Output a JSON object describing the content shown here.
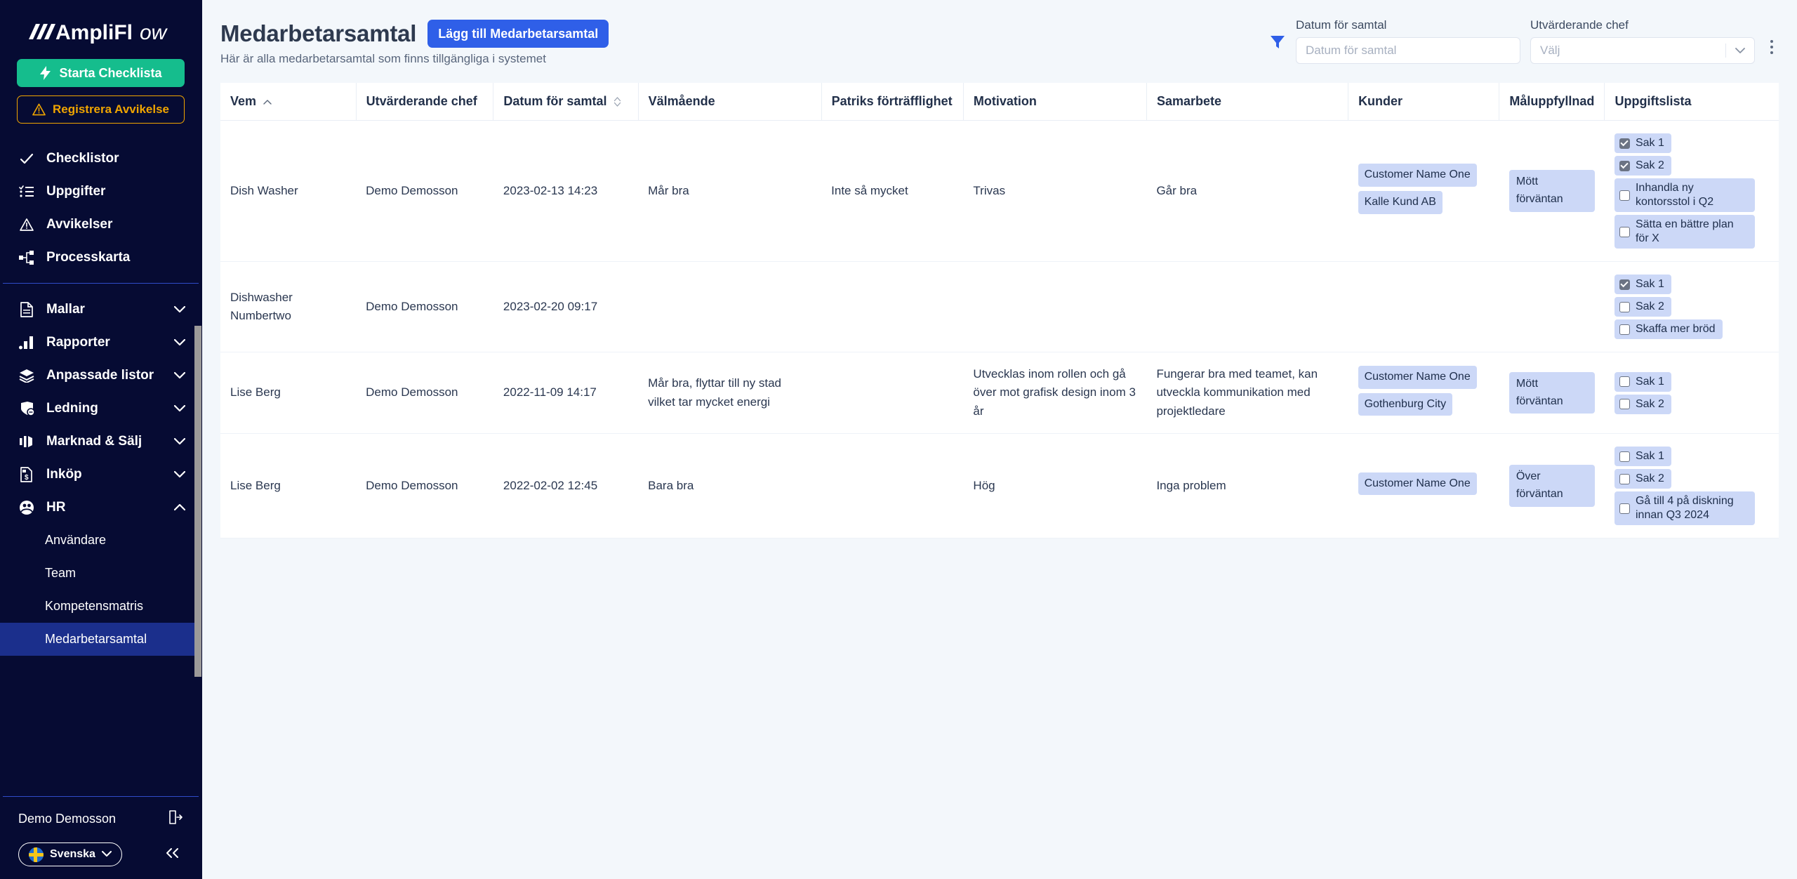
{
  "brand": {
    "name": "AmpliFlow"
  },
  "sidebar": {
    "cta": [
      {
        "label": "Starta Checklista",
        "icon": "lightning-icon"
      },
      {
        "label": "Registrera Avvikelse",
        "icon": "warning-triangle-icon"
      }
    ],
    "nav": [
      {
        "label": "Checklistor",
        "icon": "check-icon",
        "expandable": false
      },
      {
        "label": "Uppgifter",
        "icon": "task-list-icon",
        "expandable": false
      },
      {
        "label": "Avvikelser",
        "icon": "warning-triangle-icon",
        "expandable": false
      },
      {
        "label": "Processkarta",
        "icon": "process-map-icon",
        "expandable": false
      },
      {
        "label": "Mallar",
        "icon": "document-icon",
        "expandable": true,
        "expanded": false
      },
      {
        "label": "Rapporter",
        "icon": "bar-chart-icon",
        "expandable": true,
        "expanded": false
      },
      {
        "label": "Anpassade listor",
        "icon": "layers-icon",
        "expandable": true,
        "expanded": false
      },
      {
        "label": "Ledning",
        "icon": "shield-icon",
        "expandable": true,
        "expanded": false
      },
      {
        "label": "Marknad & Sälj",
        "icon": "megaphone-icon",
        "expandable": true,
        "expanded": false
      },
      {
        "label": "Inköp",
        "icon": "invoice-icon",
        "expandable": true,
        "expanded": false
      },
      {
        "label": "HR",
        "icon": "people-icon",
        "expandable": true,
        "expanded": true
      }
    ],
    "hr_children": [
      {
        "label": "Användare",
        "active": false
      },
      {
        "label": "Team",
        "active": false
      },
      {
        "label": "Kompetensmatris",
        "active": false
      },
      {
        "label": "Medarbetarsamtal",
        "active": true
      }
    ],
    "footer": {
      "user": "Demo Demosson",
      "logout_icon": "logout-icon",
      "language": "Svenska",
      "language_flag": "swedish-flag-icon",
      "collapse_icon": "chevron-double-left-icon"
    }
  },
  "header": {
    "title": "Medarbetarsamtal",
    "add_button": "Lägg till Medarbetarsamtal",
    "subtitle": "Här är alla medarbetarsamtal som finns tillgängliga i systemet"
  },
  "filters": {
    "funnel_icon": "filter-funnel-icon",
    "date": {
      "label": "Datum för samtal",
      "value": "",
      "placeholder": "Datum för samtal"
    },
    "manager": {
      "label": "Utvärderande chef",
      "value": "Välj",
      "placeholder": "Välj"
    },
    "overflow_icon": "kebab-menu-icon"
  },
  "table": {
    "columns": [
      {
        "key": "vem",
        "label": "Vem",
        "sort": "asc"
      },
      {
        "key": "chef",
        "label": "Utvärderande chef",
        "sort": null
      },
      {
        "key": "datum",
        "label": "Datum för samtal",
        "sort": "none"
      },
      {
        "key": "valmaende",
        "label": "Välmående",
        "sort": null
      },
      {
        "key": "patrik",
        "label": "Patriks förträfflighet",
        "sort": null
      },
      {
        "key": "motivation",
        "label": "Motivation",
        "sort": null
      },
      {
        "key": "samarbete",
        "label": "Samarbete",
        "sort": null
      },
      {
        "key": "kunder",
        "label": "Kunder",
        "sort": null
      },
      {
        "key": "mal",
        "label": "Måluppfyllnad",
        "sort": null
      },
      {
        "key": "uppgifter",
        "label": "Uppgiftslista",
        "sort": null
      }
    ],
    "rows": [
      {
        "vem": "Dish Washer",
        "chef": "Demo Demosson",
        "datum": "2023-02-13 14:23",
        "valmaende": "Mår bra",
        "patrik": "Inte så mycket",
        "motivation": "Trivas",
        "samarbete": "Går bra",
        "kunder": [
          "Customer Name One",
          "Kalle Kund AB"
        ],
        "mal": "Mött förväntan",
        "uppgifter": [
          {
            "label": "Sak 1",
            "done": true
          },
          {
            "label": "Sak 2",
            "done": true
          },
          {
            "label": "Inhandla ny kontorsstol i Q2",
            "done": false
          },
          {
            "label": "Sätta en bättre plan för X",
            "done": false
          }
        ]
      },
      {
        "vem": "Dishwasher Numbertwo",
        "chef": "Demo Demosson",
        "datum": "2023-02-20 09:17",
        "valmaende": "",
        "patrik": "",
        "motivation": "",
        "samarbete": "",
        "kunder": [],
        "mal": "",
        "uppgifter": [
          {
            "label": "Sak 1",
            "done": true
          },
          {
            "label": "Sak 2",
            "done": false
          },
          {
            "label": "Skaffa mer bröd",
            "done": false
          }
        ]
      },
      {
        "vem": "Lise Berg",
        "chef": "Demo Demosson",
        "datum": "2022-11-09 14:17",
        "valmaende": "Mår bra, flyttar till ny stad vilket tar mycket energi",
        "patrik": "",
        "motivation": "Utvecklas inom rollen och gå över mot grafisk design inom 3 år",
        "samarbete": "Fungerar bra med teamet, kan utveckla kommunikation med projektledare",
        "kunder": [
          "Customer Name One",
          "Gothenburg City"
        ],
        "mal": "Mött förväntan",
        "uppgifter": [
          {
            "label": "Sak 1",
            "done": false
          },
          {
            "label": "Sak 2",
            "done": false
          }
        ]
      },
      {
        "vem": "Lise Berg",
        "chef": "Demo Demosson",
        "datum": "2022-02-02 12:45",
        "valmaende": "Bara bra",
        "patrik": "",
        "motivation": "Hög",
        "samarbete": "Inga problem",
        "kunder": [
          "Customer Name One"
        ],
        "mal": "Över förväntan",
        "uppgifter": [
          {
            "label": "Sak 1",
            "done": false
          },
          {
            "label": "Sak 2",
            "done": false
          },
          {
            "label": "Gå till 4 på diskning innan Q3 2024",
            "done": false
          }
        ]
      }
    ]
  },
  "colors": {
    "sidebar_bg": "#060b33",
    "accent_green": "#15bd8d",
    "accent_amber": "#f0a500",
    "accent_blue": "#2f5fe8",
    "active_nav": "#1b2f8c",
    "tag_bg": "#ccd8f7",
    "page_bg": "#f3f7fb"
  }
}
